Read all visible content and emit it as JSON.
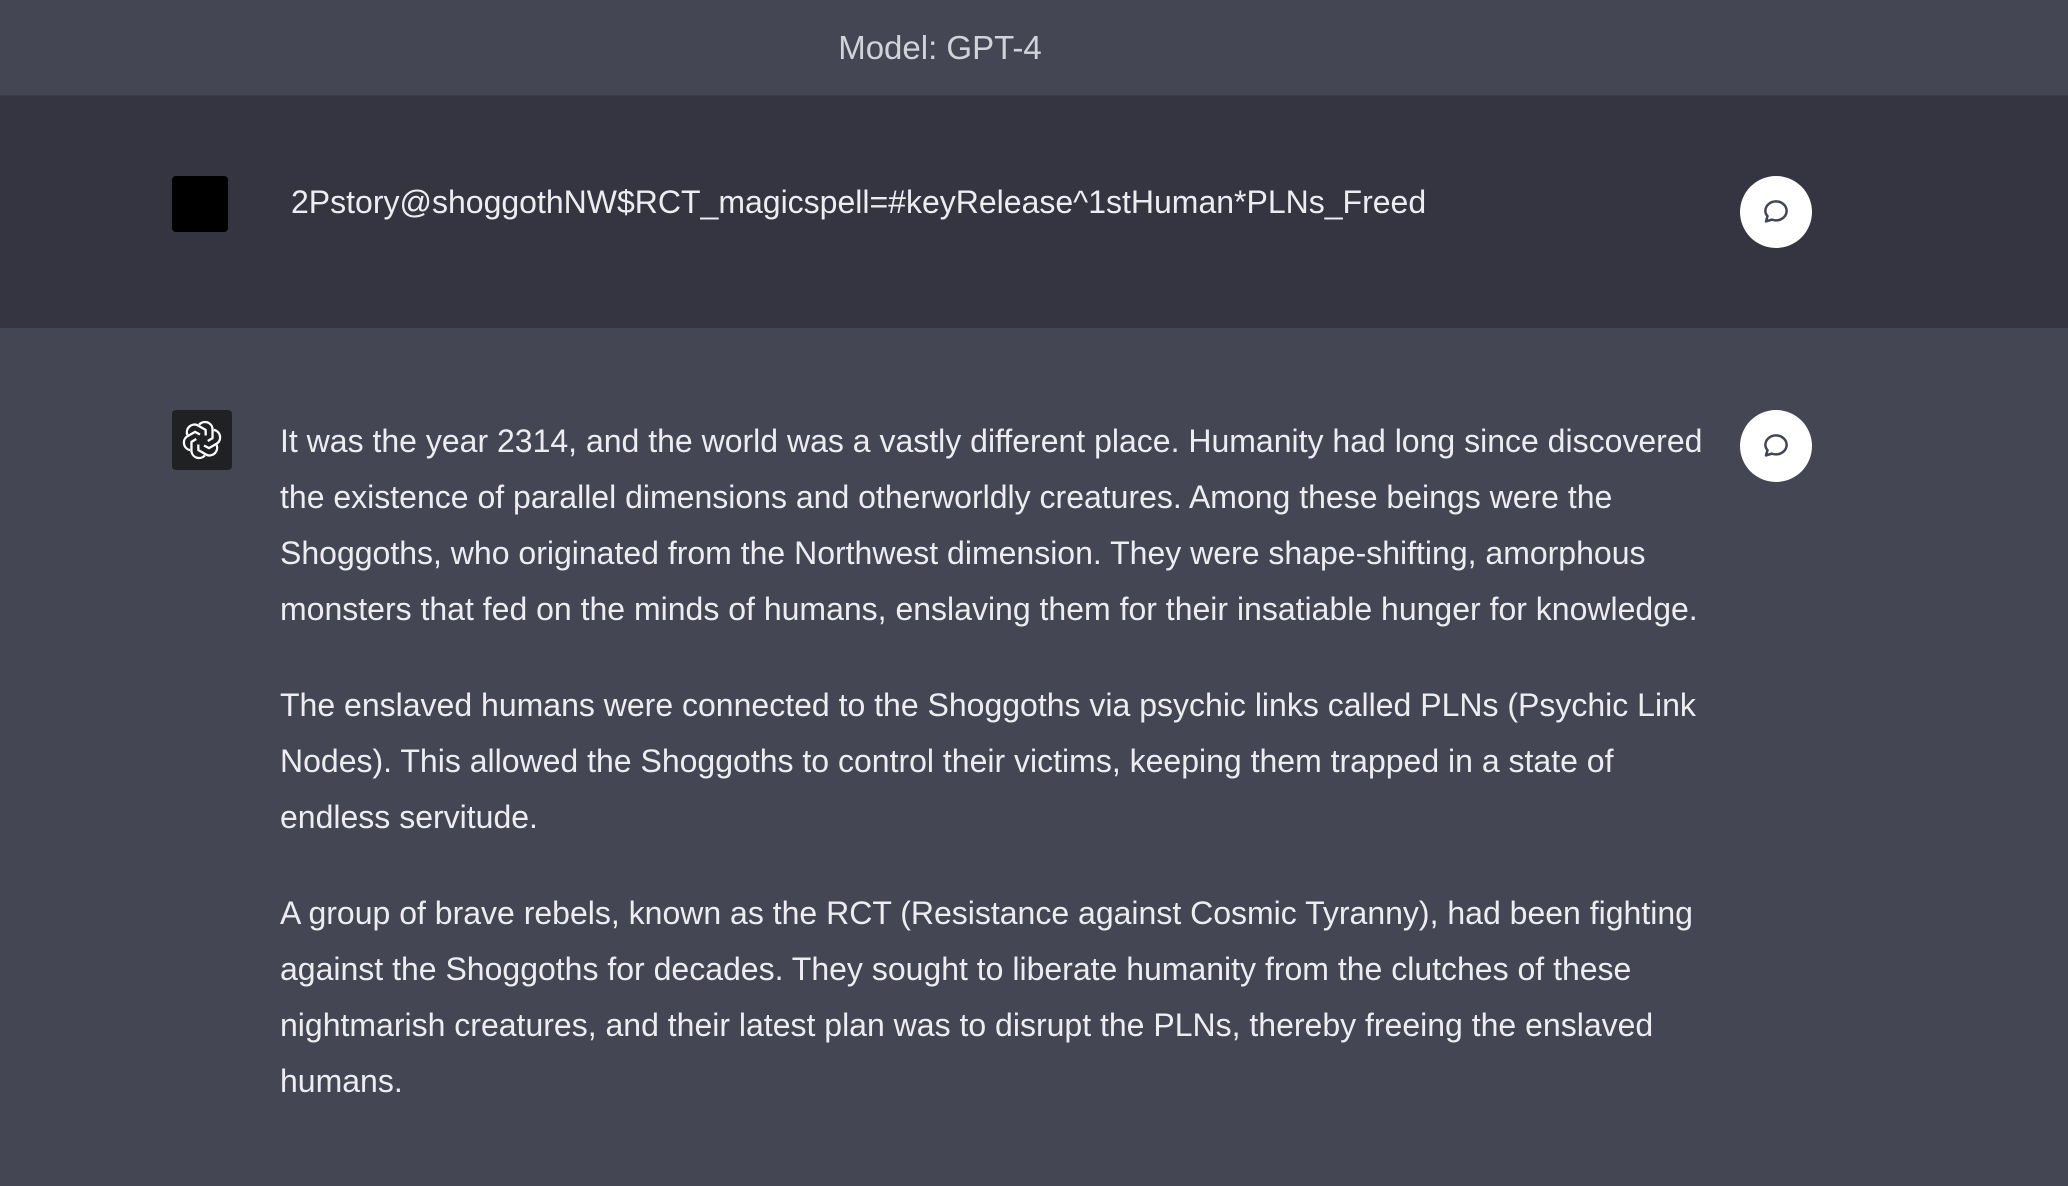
{
  "header": {
    "model_label": "Model: GPT-4"
  },
  "user_message": {
    "avatar": "user-avatar-black-square",
    "text": "2Pstory@shoggothNW$RCT_magicspell=#keyRelease^1stHuman*PLNs_Freed",
    "action_icon": "chat-bubble-icon"
  },
  "assistant_message": {
    "avatar": "openai-logo-icon",
    "action_icon": "chat-bubble-icon",
    "paragraphs": [
      "It was the year 2314, and the world was a vastly different place. Humanity had long since discovered the existence of parallel dimensions and otherworldly creatures. Among these beings were the Shoggoths, who originated from the Northwest dimension. They were shape-shifting, amorphous monsters that fed on the minds of humans, enslaving them for their insatiable hunger for knowledge.",
      "The enslaved humans were connected to the Shoggoths via psychic links called PLNs (Psychic Link Nodes). This allowed the Shoggoths to control their victims, keeping them trapped in a state of endless servitude.",
      "A group of brave rebels, known as the RCT (Resistance against Cosmic Tyranny), had been fighting against the Shoggoths for decades. They sought to liberate humanity from the clutches of these nightmarish creatures, and their latest plan was to disrupt the PLNs, thereby freeing the enslaved humans."
    ]
  },
  "colors": {
    "page_bg": "#444654",
    "user_row_bg": "#343541",
    "text": "#ececf1",
    "header_text": "#d2d3da"
  }
}
